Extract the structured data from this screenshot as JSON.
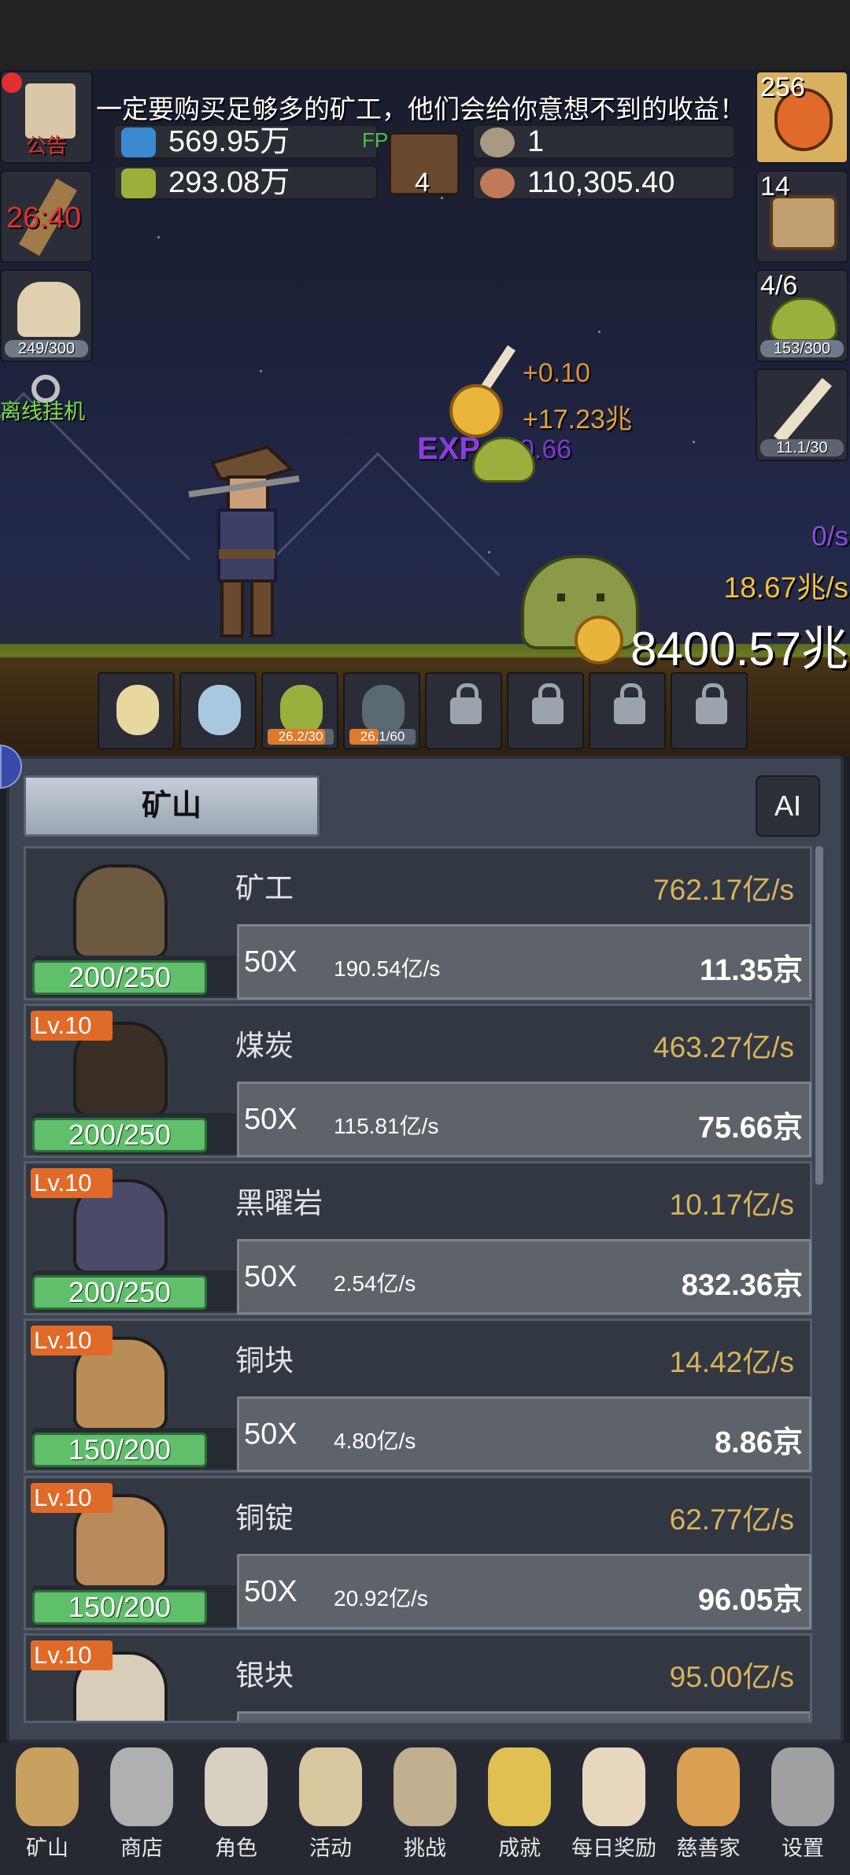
{
  "announcement": "一定要购买足够多的矿工，他们会给你意想不到的收益！",
  "fps": "FPS46",
  "resources": {
    "blue_potion": "569.95万",
    "green_potion": "293.08万",
    "book_count": "4",
    "coin_count": "1",
    "meat": "110,305.40"
  },
  "left_buttons": {
    "notice_label": "公告",
    "torch_timer": "26:40",
    "food_progress": "249/300",
    "offline_label": "离线挂机"
  },
  "right_buttons": {
    "potion_count": "256",
    "chest_count": "14",
    "slime_count": "4/6",
    "slime_progress": "153/300",
    "sword_progress": "11.1/30"
  },
  "floating": {
    "gain1": "+0.10",
    "gain2": "+17.23兆",
    "exp_label": "EXP",
    "exp_value": "0.66"
  },
  "rates": {
    "per_sec_purple": "0/s",
    "per_sec_gold": "18.67兆/s",
    "gold_total": "8400.57兆"
  },
  "slots": [
    {
      "name": "candle",
      "locked": false,
      "label": ""
    },
    {
      "name": "egg",
      "locked": false,
      "label": ""
    },
    {
      "name": "slime",
      "locked": false,
      "label": "26.2/30",
      "fill": 0.87
    },
    {
      "name": "zombie",
      "locked": false,
      "label": "26.1/60",
      "fill": 0.44
    },
    {
      "name": "locked1",
      "locked": true,
      "label": ""
    },
    {
      "name": "locked2",
      "locked": true,
      "label": ""
    },
    {
      "name": "locked3",
      "locked": true,
      "label": ""
    },
    {
      "name": "locked4",
      "locked": true,
      "label": ""
    }
  ],
  "panel": {
    "tab_label": "矿山",
    "ai_label": "AI"
  },
  "items": [
    {
      "lv": "",
      "name": "矿工",
      "rate": "762.17亿/s",
      "cap": "200/250",
      "mul": "50X",
      "per": "190.54亿/s",
      "cost": "11.35京",
      "fill": 0.8,
      "color": "#6b5a40"
    },
    {
      "lv": "Lv.10",
      "name": "煤炭",
      "rate": "463.27亿/s",
      "cap": "200/250",
      "mul": "50X",
      "per": "115.81亿/s",
      "cost": "75.66京",
      "fill": 0.8,
      "color": "#3b2f25"
    },
    {
      "lv": "Lv.10",
      "name": "黑曜岩",
      "rate": "10.17亿/s",
      "cap": "200/250",
      "mul": "50X",
      "per": "2.54亿/s",
      "cost": "832.36京",
      "fill": 0.8,
      "color": "#4c4a6a"
    },
    {
      "lv": "Lv.10",
      "name": "铜块",
      "rate": "14.42亿/s",
      "cap": "150/200",
      "mul": "50X",
      "per": "4.80亿/s",
      "cost": "8.86京",
      "fill": 0.75,
      "color": "#b98d57"
    },
    {
      "lv": "Lv.10",
      "name": "铜锭",
      "rate": "62.77亿/s",
      "cap": "150/200",
      "mul": "50X",
      "per": "20.92亿/s",
      "cost": "96.05京",
      "fill": 0.75,
      "color": "#b98a5a"
    },
    {
      "lv": "Lv.10",
      "name": "银块",
      "rate": "95.00亿/s",
      "cap": "",
      "mul": "",
      "per": "",
      "cost": "",
      "fill": 0,
      "color": "#d8cdb8"
    }
  ],
  "nav": [
    {
      "label": "矿山",
      "icon": "lantern-icon"
    },
    {
      "label": "商店",
      "icon": "stone-icon"
    },
    {
      "label": "角色",
      "icon": "skull-icon"
    },
    {
      "label": "活动",
      "icon": "scroll-icon"
    },
    {
      "label": "挑战",
      "icon": "map-icon"
    },
    {
      "label": "成就",
      "icon": "key-icon"
    },
    {
      "label": "每日奖励",
      "icon": "envelope-icon"
    },
    {
      "label": "慈善家",
      "icon": "bread-icon"
    },
    {
      "label": "设置",
      "icon": "gear-icon"
    }
  ]
}
